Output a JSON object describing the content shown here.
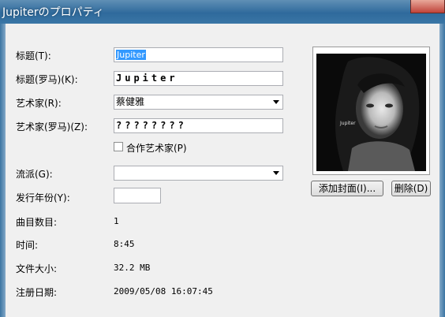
{
  "window": {
    "title": "Jupiterのプロパティ"
  },
  "labels": {
    "title": "标题(T):",
    "title_roman": "标题(罗马)(K):",
    "artist": "艺术家(R):",
    "artist_roman": "艺术家(罗马)(Z):",
    "genre": "流派(G):",
    "year": "发行年份(Y):",
    "track_number": "曲目数目:",
    "duration": "时间:",
    "file_size": "文件大小:",
    "registered_date": "注册日期:"
  },
  "fields": {
    "title_value": "Jupiter",
    "title_roman_value": "Jupiter",
    "artist_value": "蔡健雅",
    "artist_roman_value": "????????",
    "genre_value": "",
    "year_value": ""
  },
  "checkbox": {
    "label": "合作艺术家(P)",
    "checked": false
  },
  "info": {
    "track_number": "1",
    "duration": "8:45",
    "file_size": "32.2 MB",
    "registered_date": "2009/05/08 16:07:45"
  },
  "cover": {
    "caption": "Jupiter"
  },
  "buttons": {
    "add_cover": "添加封面(I)...",
    "delete": "删除(D)"
  }
}
